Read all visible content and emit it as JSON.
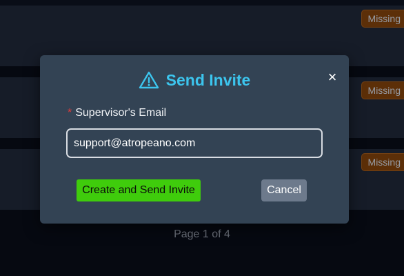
{
  "background": {
    "rows": [
      {
        "badge": "Missing"
      },
      {
        "badge": "Missing"
      },
      {
        "badge": "Missing"
      }
    ],
    "pagination": "Page 1 of 4"
  },
  "modal": {
    "title": "Send Invite",
    "title_icon": "warning-triangle-icon",
    "close_label": "×",
    "required_marker": "*",
    "email_label": "Supervisor's Email",
    "email_value": "support@atropeano.com",
    "create_button": "Create and Send Invite",
    "cancel_button": "Cancel"
  },
  "colors": {
    "title_accent": "#3cc5ee",
    "modal_bg": "#334354",
    "create_button": "#3fcc0c",
    "cancel_button": "#6d7a8c",
    "badge": "#7a3d06",
    "required": "#e23b3b"
  }
}
